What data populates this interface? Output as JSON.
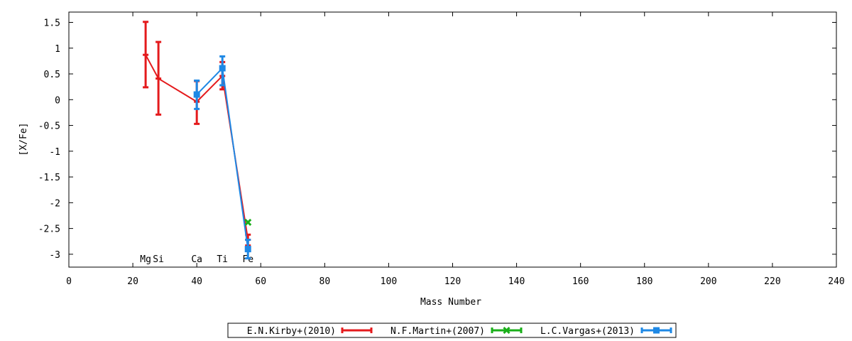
{
  "chart_data": {
    "type": "line",
    "xlabel": "Mass Number",
    "ylabel": "[X/Fe]",
    "xlim": [
      0,
      240
    ],
    "ylim": [
      -3.25,
      1.7
    ],
    "xticks": [
      0,
      20,
      40,
      60,
      80,
      100,
      120,
      140,
      160,
      180,
      200,
      220,
      240
    ],
    "yticks": [
      {
        "v": 1.5,
        "label": "1.5"
      },
      {
        "v": 1,
        "label": "1"
      },
      {
        "v": 0.5,
        "label": "0.5"
      },
      {
        "v": 0,
        "label": "0"
      },
      {
        "v": -0.5,
        "label": "-0.5"
      },
      {
        "v": -1,
        "label": "-1"
      },
      {
        "v": -1.5,
        "label": "-1.5"
      },
      {
        "v": -2,
        "label": "-2"
      },
      {
        "v": -2.5,
        "label": "-2.5"
      },
      {
        "v": -3,
        "label": "-3"
      }
    ],
    "element_labels": [
      {
        "text": "Mg",
        "x": 24
      },
      {
        "text": "Si",
        "x": 28
      },
      {
        "text": "Ca",
        "x": 40
      },
      {
        "text": "Ti",
        "x": 48
      },
      {
        "text": "Fe",
        "x": 56
      }
    ],
    "grid": false,
    "legend_position": "bottom-center",
    "series": [
      {
        "name": "E.N.Kirby+(2010)",
        "color": "#e41a1c",
        "marker": "bar",
        "points": [
          {
            "x": 24,
            "y": 0.87,
            "lo": 0.24,
            "hi": 1.51
          },
          {
            "x": 28,
            "y": 0.41,
            "lo": -0.29,
            "hi": 1.12
          },
          {
            "x": 40,
            "y": -0.04,
            "lo": -0.47,
            "hi": 0.36
          },
          {
            "x": 48,
            "y": 0.46,
            "lo": 0.2,
            "hi": 0.73
          },
          {
            "x": 56,
            "y": -2.72,
            "lo": -2.83,
            "hi": -2.62
          }
        ]
      },
      {
        "name": "N.F.Martin+(2007)",
        "color": "#1aaf1a",
        "marker": "cross",
        "points": [
          {
            "x": 56,
            "y": -2.38,
            "lo": -2.38,
            "hi": -2.38
          }
        ]
      },
      {
        "name": "L.C.Vargas+(2013)",
        "color": "#1e88e5",
        "marker": "square",
        "points": [
          {
            "x": 40,
            "y": 0.1,
            "lo": -0.18,
            "hi": 0.37
          },
          {
            "x": 48,
            "y": 0.61,
            "lo": 0.28,
            "hi": 0.84
          },
          {
            "x": 56,
            "y": -2.9,
            "lo": -3.08,
            "hi": -2.72
          }
        ]
      }
    ]
  }
}
